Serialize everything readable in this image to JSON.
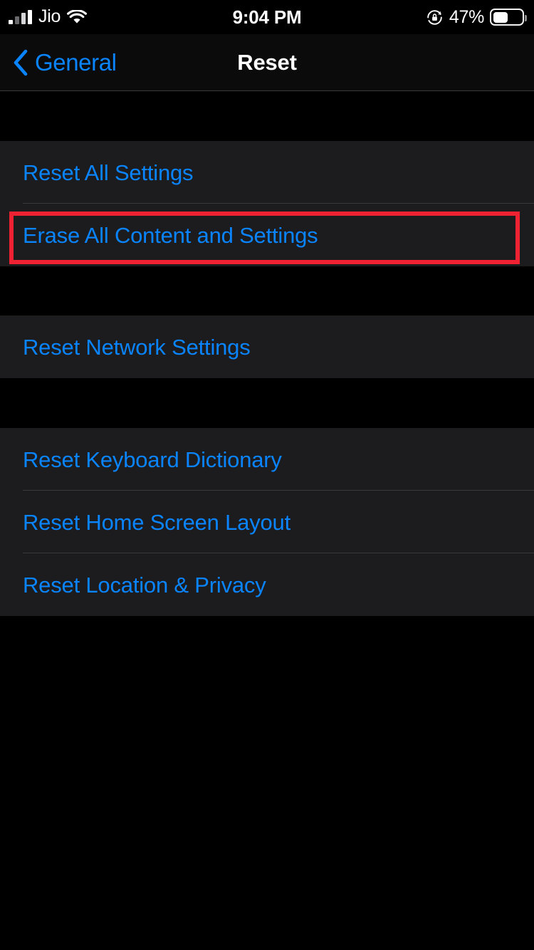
{
  "status_bar": {
    "carrier": "Jio",
    "signal_icon": "cellular-signal-icon",
    "signal_bars_filled": 1,
    "signal_bars_total": 4,
    "wifi_icon": "wifi-icon",
    "time": "9:04 PM",
    "rotation_lock_icon": "rotation-lock-icon",
    "battery_percent": "47%",
    "battery_level": 47,
    "battery_icon": "battery-icon"
  },
  "nav_bar": {
    "back_icon": "chevron-left-icon",
    "back_label": "General",
    "title": "Reset"
  },
  "colors": {
    "accent_blue": "#0a84ff",
    "page_background": "#000000",
    "cell_background": "#1c1c1e",
    "separator": "#3a3a3c",
    "highlight_red": "#ee2233"
  },
  "groups": [
    {
      "name": "reset-primary-group",
      "items": [
        {
          "label": "Reset All Settings",
          "name": "reset-all-settings"
        },
        {
          "label": "Erase All Content and Settings",
          "name": "erase-all-content-and-settings",
          "highlighted": true
        }
      ]
    },
    {
      "name": "reset-network-group",
      "items": [
        {
          "label": "Reset Network Settings",
          "name": "reset-network-settings"
        }
      ]
    },
    {
      "name": "reset-misc-group",
      "items": [
        {
          "label": "Reset Keyboard Dictionary",
          "name": "reset-keyboard-dictionary"
        },
        {
          "label": "Reset Home Screen Layout",
          "name": "reset-home-screen-layout"
        },
        {
          "label": "Reset Location & Privacy",
          "name": "reset-location-and-privacy"
        }
      ]
    }
  ],
  "annotation": {
    "target": "Erase All Content and Settings",
    "shape": "rectangle-outline",
    "color": "#ee2233"
  }
}
